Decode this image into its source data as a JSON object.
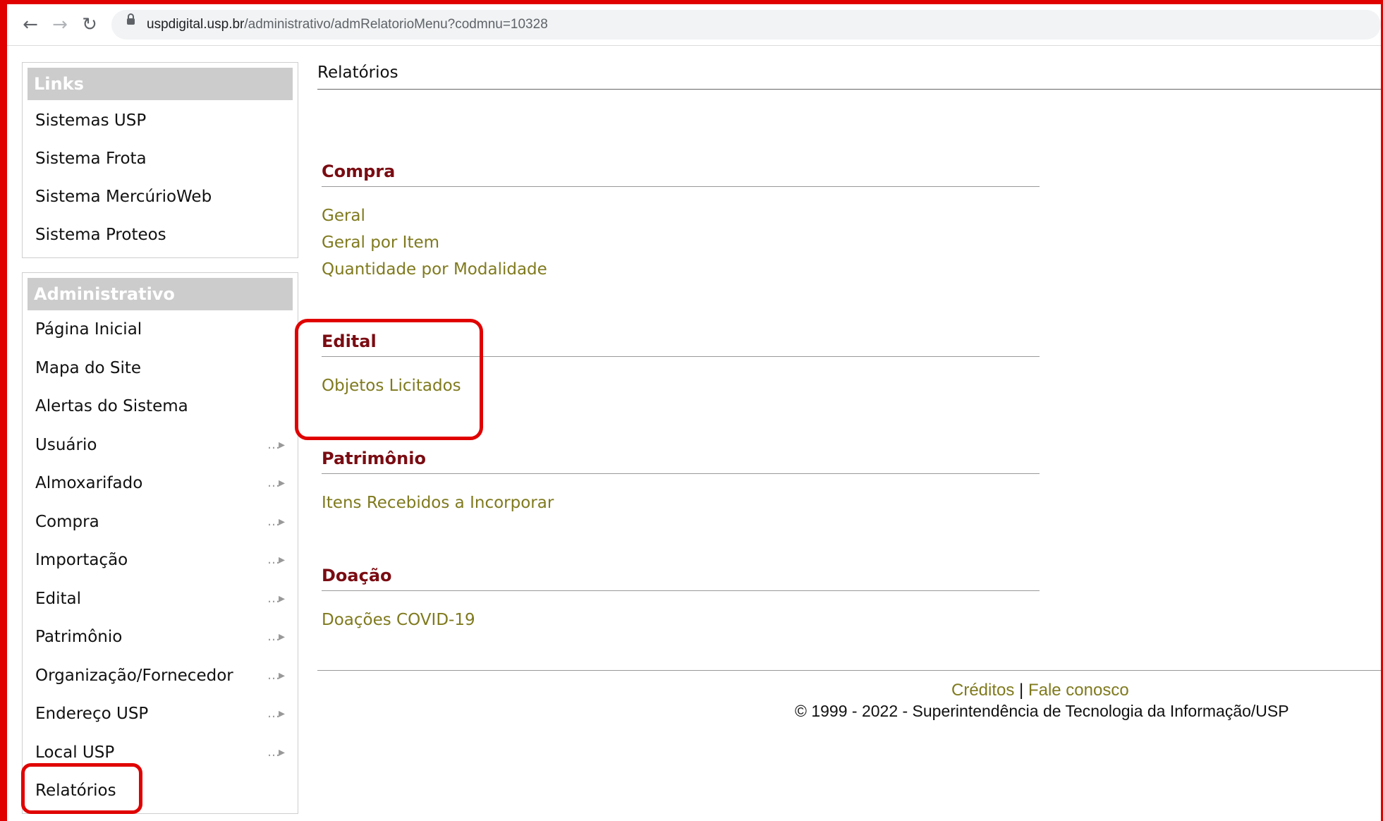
{
  "browser": {
    "url_host": "uspdigital.usp.br",
    "url_path": "/administrativo/admRelatorioMenu?codmnu=10328"
  },
  "sidebar": {
    "links": {
      "title": "Links",
      "items": [
        {
          "label": "Sistemas USP"
        },
        {
          "label": "Sistema Frota"
        },
        {
          "label": "Sistema MercúrioWeb"
        },
        {
          "label": "Sistema Proteos"
        }
      ]
    },
    "admin": {
      "title": "Administrativo",
      "items": [
        {
          "label": "Página Inicial"
        },
        {
          "label": "Mapa do Site"
        },
        {
          "label": "Alertas do Sistema"
        },
        {
          "label": "Usuário"
        },
        {
          "label": "Almoxarifado"
        },
        {
          "label": "Compra"
        },
        {
          "label": "Importação"
        },
        {
          "label": "Edital"
        },
        {
          "label": "Patrimônio"
        },
        {
          "label": "Organização/Fornecedor"
        },
        {
          "label": "Endereço USP"
        },
        {
          "label": "Local USP"
        },
        {
          "label": "Relatórios"
        }
      ]
    }
  },
  "main": {
    "title": "Relatórios",
    "sections": [
      {
        "title": "Compra",
        "links": [
          "Geral",
          "Geral por Item",
          "Quantidade por Modalidade"
        ]
      },
      {
        "title": "Edital",
        "links": [
          "Objetos Licitados"
        ]
      },
      {
        "title": "Patrimônio",
        "links": [
          "Itens Recebidos a Incorporar"
        ]
      },
      {
        "title": "Doação",
        "links": [
          "Doações COVID-19"
        ]
      }
    ]
  },
  "footer": {
    "creditos": "Créditos",
    "separator": "|",
    "fale_conosco": "Fale conosco",
    "copyright": "© 1999 - 2022 - Superintendência de Tecnologia da Informação/USP"
  },
  "colors": {
    "highlight": "#e00000",
    "section_title": "#7a0c12",
    "link": "#7f7a1e",
    "panel_header": "#cccccc"
  }
}
